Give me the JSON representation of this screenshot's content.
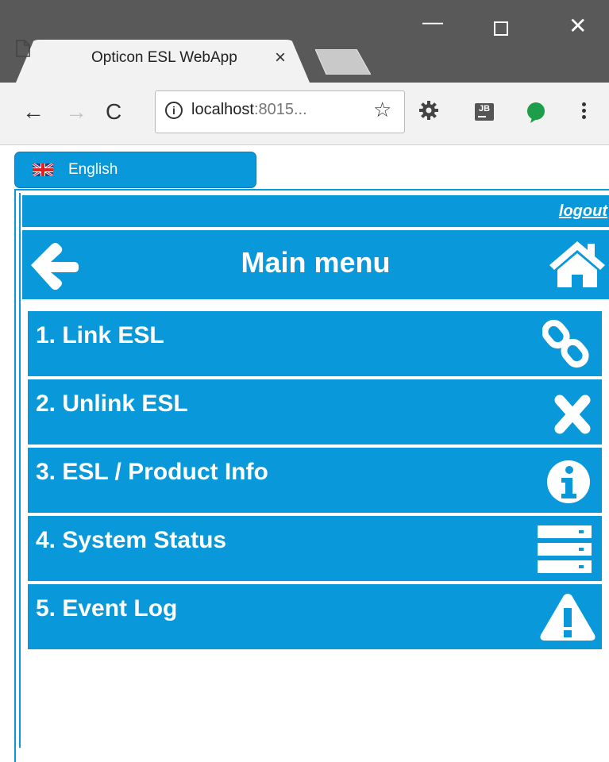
{
  "browser": {
    "tab_title": "Opticon ESL WebApp",
    "tab_close": "×",
    "window_minimize": "—",
    "window_close": "✕",
    "nav_back": "←",
    "nav_forward": "→",
    "nav_reload": "C",
    "url_host": "localhost",
    "url_rest": ":8015...",
    "bookmark_star": "☆",
    "info_icon": "i",
    "ext_jb_label": "JB"
  },
  "language": {
    "label": "English",
    "flag": "uk-flag-icon"
  },
  "header": {
    "logout": "logout",
    "title": "Main menu"
  },
  "menu": {
    "items": [
      {
        "label": "1. Link ESL",
        "icon": "link-icon"
      },
      {
        "label": "2. Unlink ESL",
        "icon": "close-icon"
      },
      {
        "label": "3. ESL / Product Info",
        "icon": "info-icon"
      },
      {
        "label": "4. System Status",
        "icon": "server-icon"
      },
      {
        "label": "5. Event Log",
        "icon": "warning-icon"
      }
    ]
  },
  "colors": {
    "accent": "#0998d9",
    "chrome_dark": "#595959",
    "toolbar": "#f2f2f2"
  }
}
